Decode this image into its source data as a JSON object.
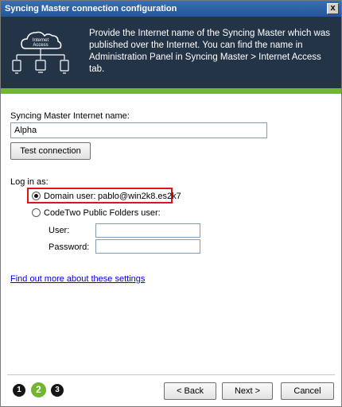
{
  "window": {
    "title": "Syncing Master connection configuration",
    "close_glyph": "x"
  },
  "header": {
    "icon_label_1": "Internet",
    "icon_label_2": "Access",
    "description": "Provide the Internet name of the Syncing Master which was published over the Internet. You can find the name in Administration Panel in  Syncing Master > Internet Access tab.",
    "accent_color": "#72b52e",
    "background_color": "#243447"
  },
  "form": {
    "internet_name_label": "Syncing Master Internet name:",
    "internet_name_value": "Alpha",
    "test_connection_label": "Test connection",
    "login_as_label": "Log in as:",
    "domain_user_label": "Domain user:",
    "domain_user_value": "pablo@win2k8.es2k7",
    "domain_user_selected": true,
    "public_folders_user_label": "CodeTwo Public Folders user:",
    "user_label": "User:",
    "user_value": "",
    "password_label": "Password:",
    "password_value": "",
    "help_link": "Find out more about these settings"
  },
  "footer": {
    "steps": [
      "1",
      "2",
      "3"
    ],
    "active_step": "2",
    "back_label": "< Back",
    "next_label": "Next >",
    "cancel_label": "Cancel"
  }
}
